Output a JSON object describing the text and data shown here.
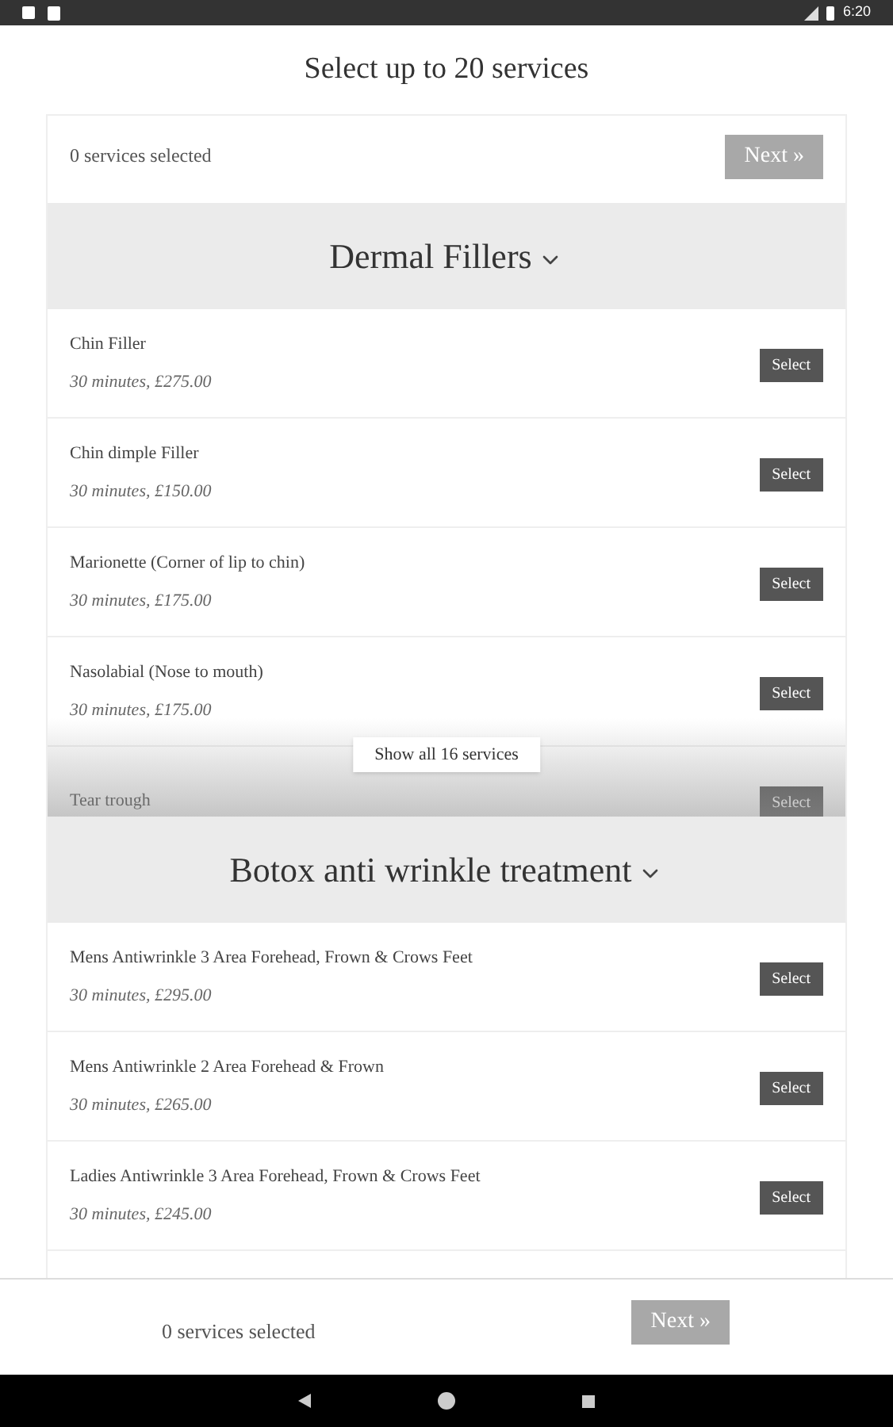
{
  "status_bar": {
    "time": "6:20"
  },
  "title": "Select up to 20 services",
  "top_bar": {
    "count": "0 services selected",
    "next": {
      "label": "Next »",
      "disabled": true
    }
  },
  "categories": [
    {
      "name": "Dermal Fillers",
      "expanded": true,
      "services": [
        {
          "name": "Chin Filler",
          "details": "30 minutes, £275.00",
          "button": "Select"
        },
        {
          "name": "Chin dimple Filler",
          "details": "30 minutes, £150.00",
          "button": "Select"
        },
        {
          "name": "Marionette (Corner of lip to chin)",
          "details": "30 minutes, £175.00",
          "button": "Select"
        },
        {
          "name": "Nasolabial (Nose to mouth)",
          "details": "30 minutes, £175.00",
          "button": "Select"
        },
        {
          "name": "Tear trough",
          "button": "Select"
        }
      ],
      "show_all": "Show all 16 services"
    },
    {
      "name": "Botox anti wrinkle treatment",
      "expanded": true,
      "services": [
        {
          "name": "Mens Antiwrinkle 3 Area Forehead, Frown & Crows Feet",
          "details": "30 minutes, £295.00",
          "button": "Select"
        },
        {
          "name": "Mens Antiwrinkle 2 Area Forehead & Frown",
          "details": "30 minutes, £265.00",
          "button": "Select"
        },
        {
          "name": "Ladies Antiwrinkle 3 Area Forehead, Frown & Crows Feet",
          "details": "30 minutes, £245.00",
          "button": "Select"
        }
      ]
    }
  ],
  "bottom_bar": {
    "count": "0 services selected",
    "next": {
      "label": "Next »",
      "disabled": true
    }
  }
}
